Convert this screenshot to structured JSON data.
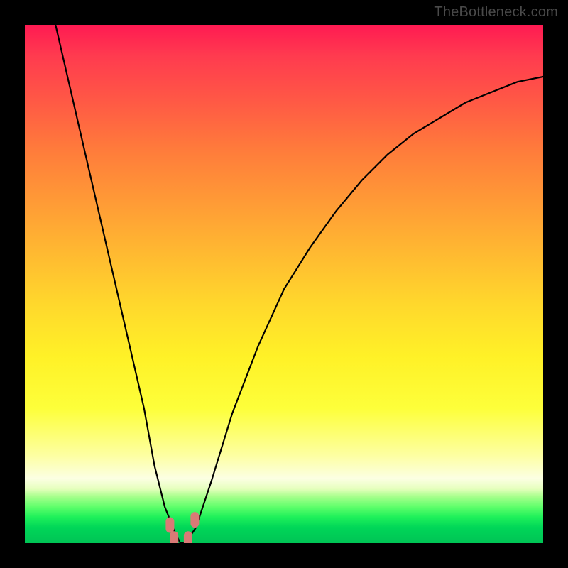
{
  "watermark": "TheBottleneck.com",
  "chart_data": {
    "type": "line",
    "title": "",
    "xlabel": "",
    "ylabel": "",
    "xlim": [
      0,
      100
    ],
    "ylim": [
      0,
      100
    ],
    "grid": false,
    "legend": false,
    "series": [
      {
        "name": "bottleneck-curve",
        "x": [
          5,
          8,
          11,
          14,
          17,
          20,
          23,
          25,
          27,
          29,
          30,
          31,
          33,
          36,
          40,
          45,
          50,
          55,
          60,
          65,
          70,
          75,
          80,
          85,
          90,
          95,
          100
        ],
        "y": [
          104,
          91,
          78,
          65,
          52,
          39,
          26,
          15,
          7,
          2,
          0,
          0,
          3,
          12,
          25,
          38,
          49,
          57,
          64,
          70,
          75,
          79,
          82,
          85,
          87,
          89,
          90
        ]
      }
    ],
    "markers": [
      {
        "name": "min-left-edge",
        "x": 28.0,
        "y": 3.5
      },
      {
        "name": "min-floor-a",
        "x": 28.8,
        "y": 0.8
      },
      {
        "name": "min-floor-b",
        "x": 31.5,
        "y": 0.8
      },
      {
        "name": "min-right-edge",
        "x": 32.8,
        "y": 4.5
      }
    ],
    "colors": {
      "curve": "#000000",
      "marker": "#d97a76",
      "gradient_top": "#ff1a52",
      "gradient_bottom": "#00c455"
    }
  }
}
